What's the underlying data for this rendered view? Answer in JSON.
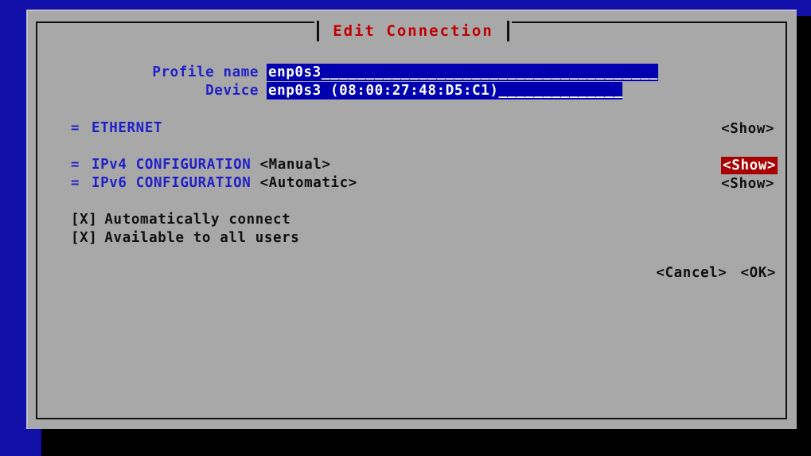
{
  "window": {
    "title": "Edit Connection",
    "title_color": "#c00000",
    "background_color": "#a8a8a8",
    "desktop_color": "#1010a8"
  },
  "form": {
    "profile_name": {
      "label": "Profile name",
      "value": "enp0s3",
      "filler": "______________________________________"
    },
    "device": {
      "label": "Device",
      "value": "enp0s3 (08:00:27:48:D5:C1)",
      "filler": "______________"
    }
  },
  "sections": [
    {
      "marker": "=",
      "title": "ETHERNET",
      "value": "",
      "action_label": "<Show>",
      "focused": false
    },
    {
      "marker": "=",
      "title": "IPv4 CONFIGURATION",
      "value": "<Manual>",
      "action_label": "<Show>",
      "focused": true
    },
    {
      "marker": "=",
      "title": "IPv6 CONFIGURATION",
      "value": "<Automatic>",
      "action_label": "<Show>",
      "focused": false
    }
  ],
  "checkboxes": [
    {
      "mark": "[X]",
      "label": "Automatically connect",
      "checked": true
    },
    {
      "mark": "[X]",
      "label": "Available to all users",
      "checked": true
    }
  ],
  "buttons": {
    "cancel": "<Cancel>",
    "ok": "<OK>"
  },
  "colors": {
    "focus_background": "#a80000",
    "field_background": "#0000b0",
    "label_text": "#2020c8"
  }
}
